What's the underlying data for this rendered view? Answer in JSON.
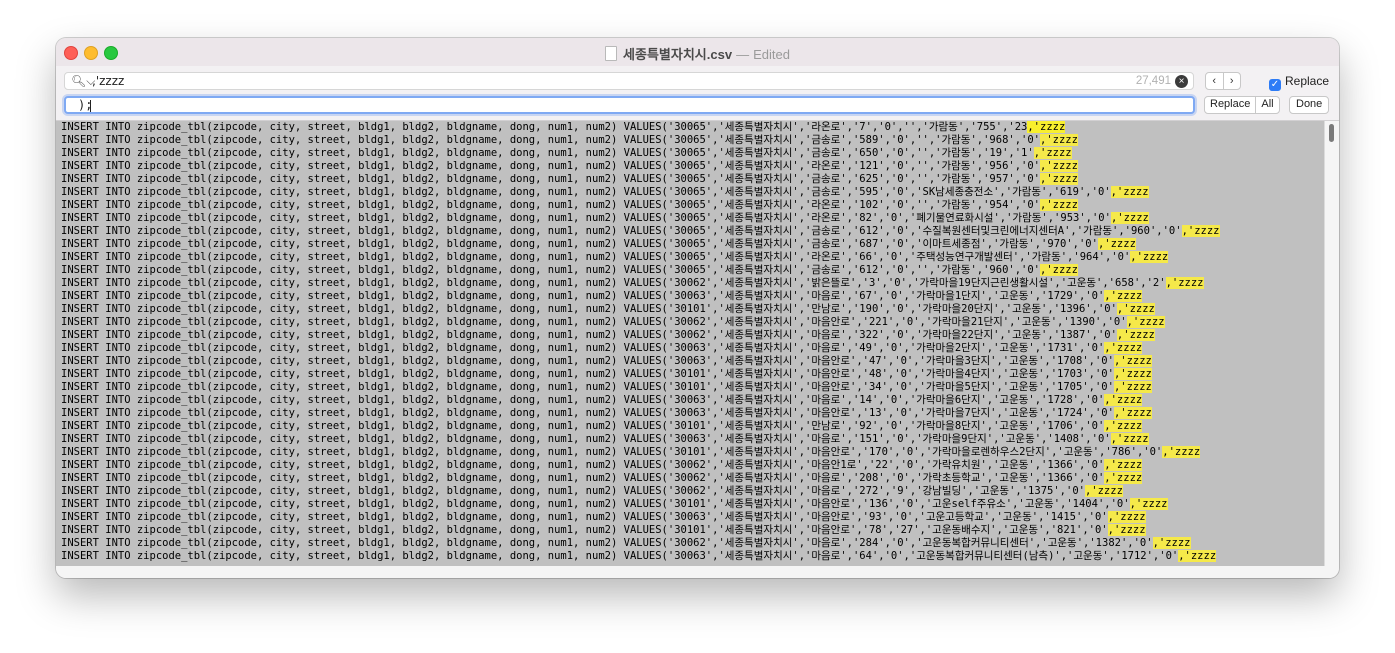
{
  "window": {
    "title": "세종특별자치시.csv",
    "separator": "—",
    "status": "Edited"
  },
  "find": {
    "query": ",'zzzz",
    "count": "27,491",
    "prev_icon": "chevron-left-icon",
    "next_icon": "chevron-right-icon",
    "replace_label": "Replace",
    "replace_checked": true
  },
  "replace": {
    "value": ");",
    "replace_button": "Replace",
    "all_button": "All",
    "done_button": "Done"
  },
  "editor": {
    "prefix": "INSERT INTO zipcode_tbl(zipcode, city, street, bldg1, bldg2, bldgname, dong, num1, num2) VALUES(",
    "match": ",'zzzz",
    "lines": [
      "'30065','세종특별자치시','라온로','7','0','','가람동','755','23",
      "'30065','세종특별자치시','금송로','589','0','','가람동','968','0'",
      "'30065','세종특별자치시','금송로','650','0','','가람동','19','1'",
      "'30065','세종특별자치시','라온로','121','0','','가람동','956','0'",
      "'30065','세종특별자치시','금송로','625','0','','가람동','957','0'",
      "'30065','세종특별자치시','금송로','595','0','SK남세종충전소','가람동','619','0'",
      "'30065','세종특별자치시','라온로','102','0','','가람동','954','0'",
      "'30065','세종특별자치시','라온로','82','0','폐기물연료화시설','가람동','953','0'",
      "'30065','세종특별자치시','금송로','612','0','수질복원센터및크린에너지센터A','가람동','960','0'",
      "'30065','세종특별자치시','금송로','687','0','이마트세종점','가람동','970','0'",
      "'30065','세종특별자치시','라온로','66','0','주택성능연구개발센터','가람동','964','0'",
      "'30065','세종특별자치시','금송로','612','0','','가람동','960','0'",
      "'30062','세종특별자치시','밝은뜰로','3','0','가락마을19단지근린생활시설','고운동','658','2'",
      "'30063','세종특별자치시','마음로','67','0','가락마을1단지','고운동','1729','0'",
      "'30101','세종특별자치시','만남로','190','0','가락마을20단지','고운동','1396','0'",
      "'30062','세종특별자치시','마음안로','221','0','가락마을21단지','고운동','1390','0'",
      "'30062','세종특별자치시','마음로','322','0','가락마을22단지','고운동','1387','0'",
      "'30063','세종특별자치시','마음로','49','0','가락마을2단지','고운동','1731','0'",
      "'30063','세종특별자치시','마음안로','47','0','가락마을3단지','고운동','1708','0'",
      "'30101','세종특별자치시','마음안로','48','0','가락마을4단지','고운동','1703','0'",
      "'30101','세종특별자치시','마음안로','34','0','가락마을5단지','고운동','1705','0'",
      "'30063','세종특별자치시','마음로','14','0','가락마을6단지','고운동','1728','0'",
      "'30063','세종특별자치시','마음안로','13','0','가락마을7단지','고운동','1724','0'",
      "'30101','세종특별자치시','만남로','92','0','가락마을8단지','고운동','1706','0'",
      "'30063','세종특별자치시','마음로','151','0','가락마을9단지','고운동','1408','0'",
      "'30101','세종특별자치시','마음안로','170','0','가락마을로렌하우스2단지','고운동','786','0'",
      "'30062','세종특별자치시','마음안1로','22','0','가락유치원','고운동','1366','0'",
      "'30062','세종특별자치시','마음로','208','0','가락초등학교','고운동','1366','0'",
      "'30062','세종특별자치시','마음로','272','9','강남빌딩','고운동','1375','0'",
      "'30101','세종특별자치시','마음안로','136','0','고운self주유소','고운동','1404','0'",
      "'30063','세종특별자치시','마음안로','93','0','고운고등학교','고운동','1415','0'",
      "'30101','세종특별자치시','마음안로','78','27','고운동배수지','고운동','821','0'",
      "'30062','세종특별자치시','마음로','284','0','고운동복합커뮤니티센터','고운동','1382','0'",
      "'30063','세종특별자치시','마음로','64','0','고운동복합커뮤니티센터(남측)','고운동','1712','0'"
    ]
  }
}
